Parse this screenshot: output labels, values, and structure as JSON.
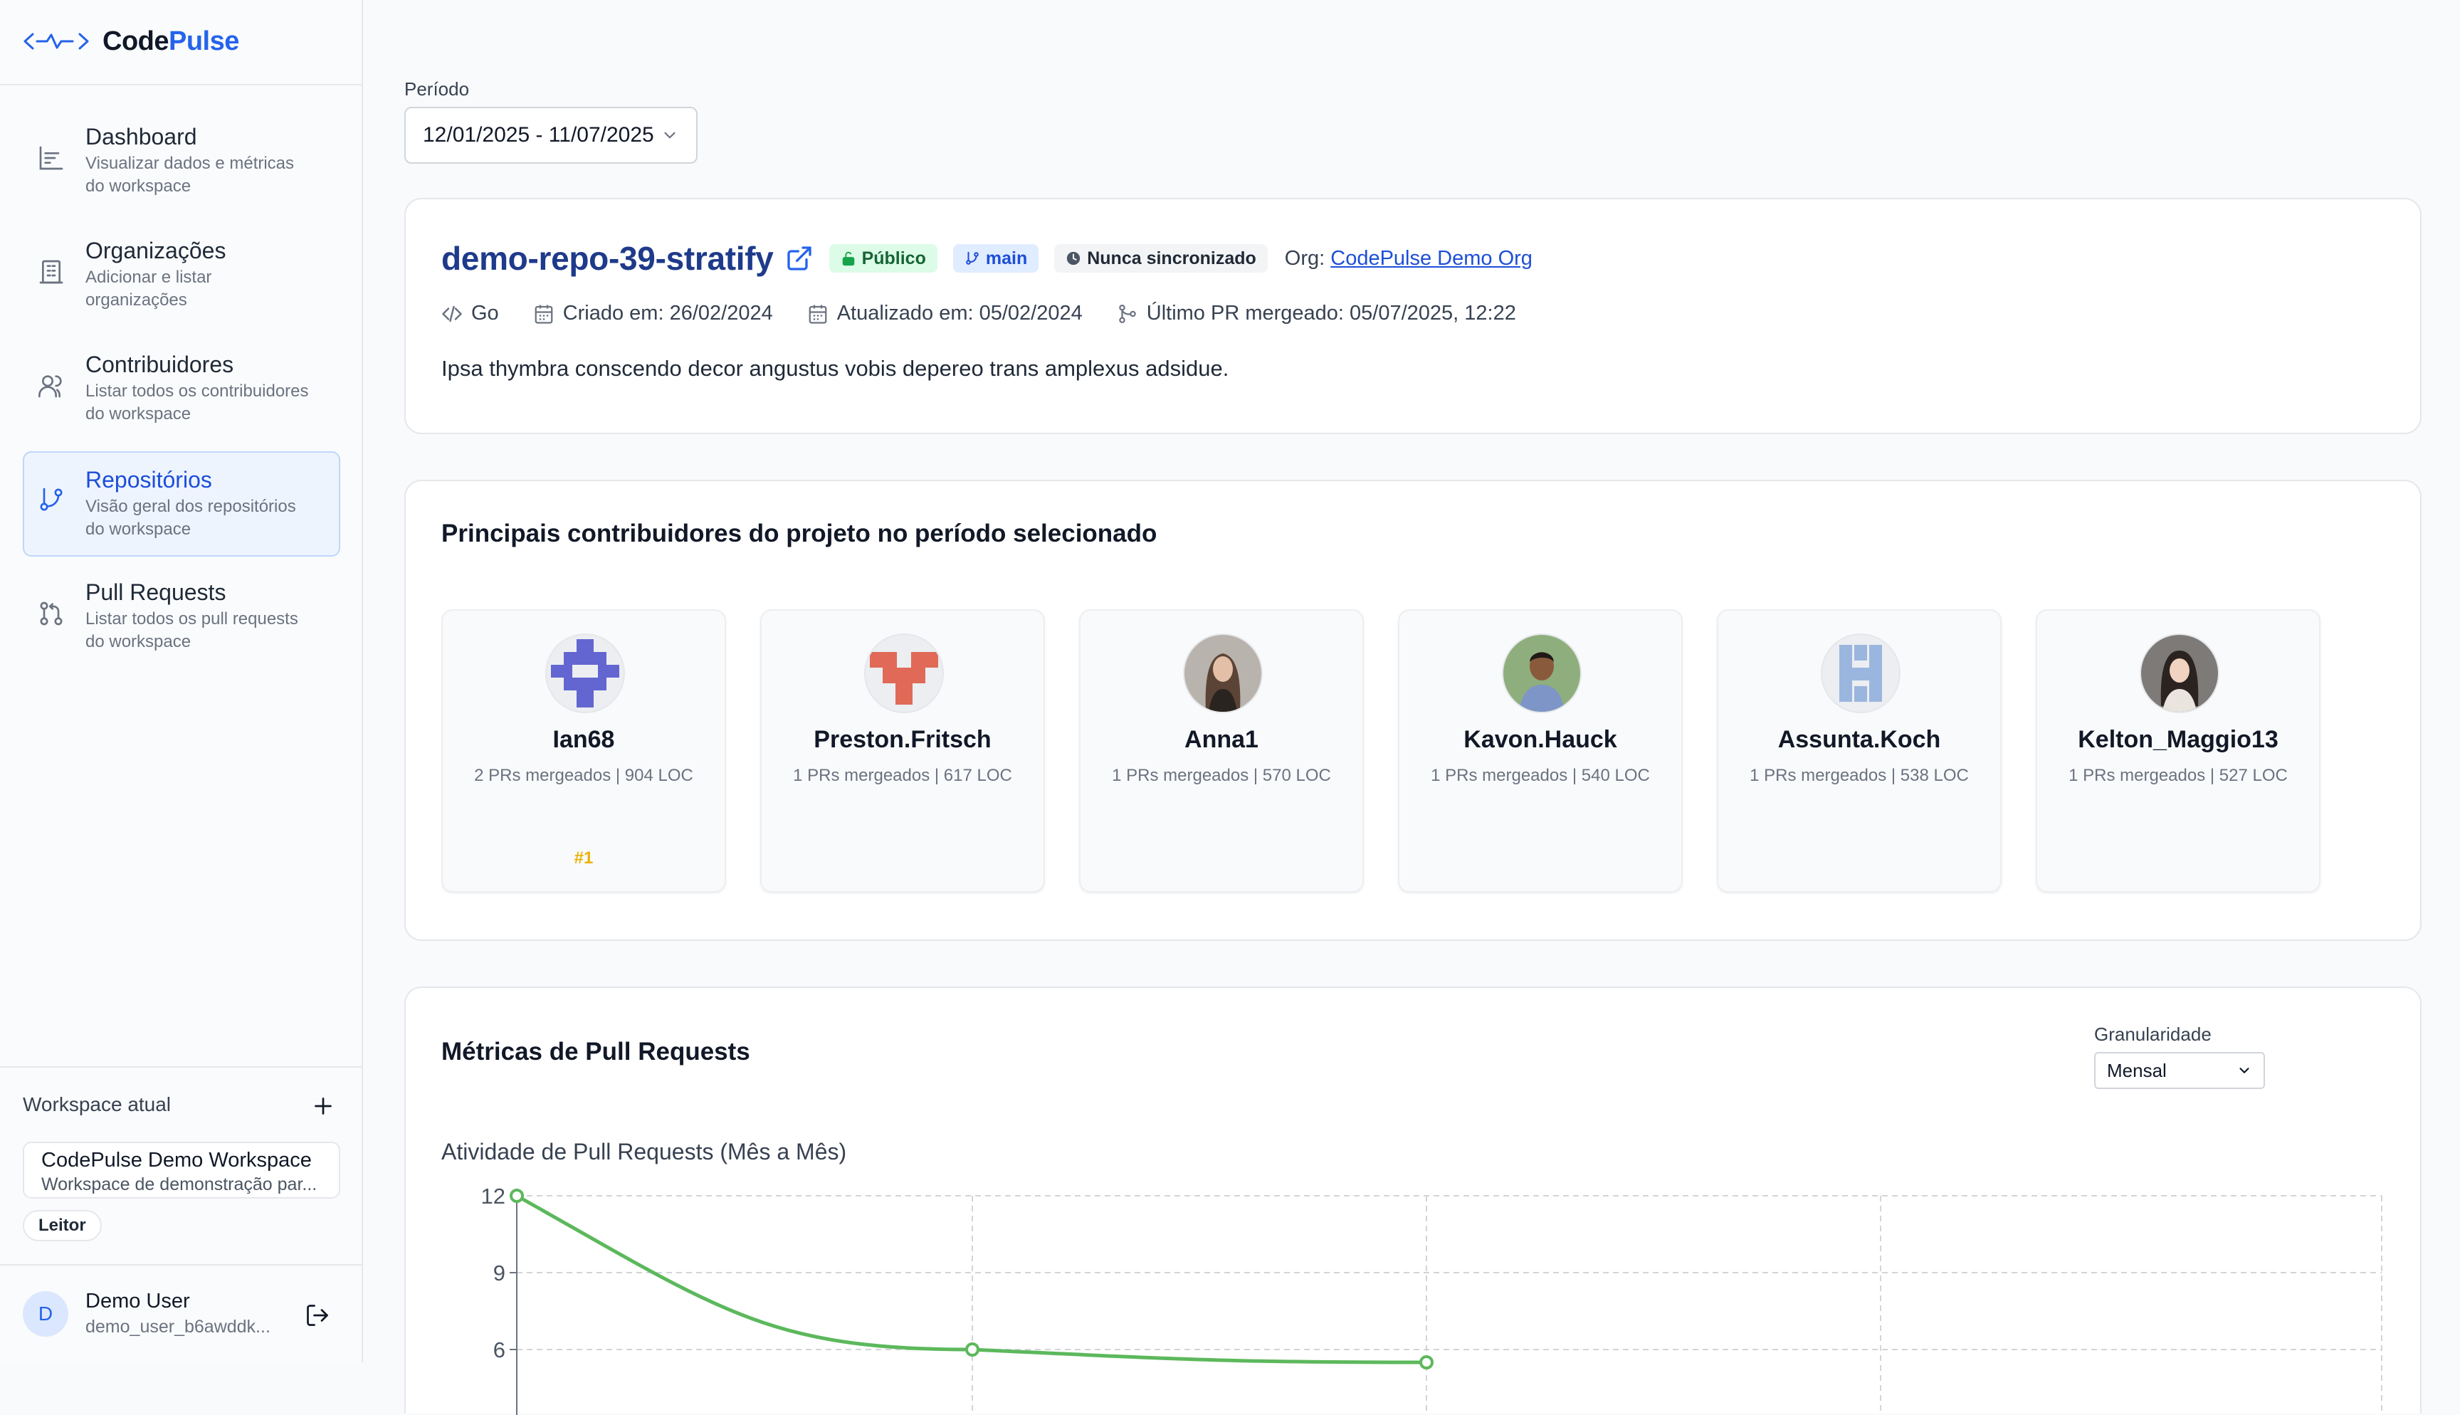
{
  "brand": {
    "name_a": "Code",
    "name_b": "Pulse"
  },
  "nav": [
    {
      "id": "dashboard",
      "label": "Dashboard",
      "sub": "Visualizar dados e métricas do workspace",
      "active": false
    },
    {
      "id": "organizacoes",
      "label": "Organizações",
      "sub": "Adicionar e listar organizações",
      "active": false
    },
    {
      "id": "contribuidores",
      "label": "Contribuidores",
      "sub": "Listar todos os contribuidores do workspace",
      "active": false
    },
    {
      "id": "repositorios",
      "label": "Repositórios",
      "sub": "Visão geral dos repositórios do workspace",
      "active": true
    },
    {
      "id": "pull-requests",
      "label": "Pull Requests",
      "sub": "Listar todos os pull requests do workspace",
      "active": false
    }
  ],
  "workspace": {
    "title": "Workspace atual",
    "name": "CodePulse Demo Workspace",
    "description": "Workspace de demonstração par...",
    "role": "Leitor"
  },
  "user": {
    "initial": "D",
    "name": "Demo User",
    "id": "demo_user_b6awddk..."
  },
  "period": {
    "label": "Período",
    "value": "12/01/2025 - 11/07/2025"
  },
  "repo": {
    "name": "demo-repo-39-stratify",
    "visibility": "Público",
    "branch": "main",
    "sync": "Nunca sincronizado",
    "org_label": "Org:",
    "org_name": "CodePulse Demo Org",
    "language": "Go",
    "created": "Criado em: 26/02/2024",
    "updated": "Atualizado em: 05/02/2024",
    "last_pr": "Último PR mergeado: 05/07/2025, 12:22",
    "description": "Ipsa thymbra conscendo decor angustus vobis depereo trans amplexus adsidue."
  },
  "contributors": {
    "title": "Principais contribuidores do projeto no período selecionado",
    "items": [
      {
        "name": "Ian68",
        "stats": "2 PRs mergeados | 904 LOC",
        "rank": "#1",
        "avatar": "identicon",
        "color": "#6366d1"
      },
      {
        "name": "Preston.Fritsch",
        "stats": "1 PRs mergeados | 617 LOC",
        "rank": "",
        "avatar": "identicon",
        "color": "#e06a57"
      },
      {
        "name": "Anna1",
        "stats": "1 PRs mergeados | 570 LOC",
        "rank": "",
        "avatar": "photo",
        "color": "#5b4436"
      },
      {
        "name": "Kavon.Hauck",
        "stats": "1 PRs mergeados | 540 LOC",
        "rank": "",
        "avatar": "photo",
        "color": "#6b4a32"
      },
      {
        "name": "Assunta.Koch",
        "stats": "1 PRs mergeados | 538 LOC",
        "rank": "",
        "avatar": "identicon",
        "color": "#9bb6de"
      },
      {
        "name": "Kelton_Maggio13",
        "stats": "1 PRs mergeados | 527 LOC",
        "rank": "",
        "avatar": "photo",
        "color": "#2b2320"
      }
    ]
  },
  "metrics": {
    "title": "Métricas de Pull Requests",
    "granularity_label": "Granularidade",
    "granularity_value": "Mensal"
  },
  "chart_data": {
    "type": "line",
    "title": "Atividade de Pull Requests (Mês a Mês)",
    "xlabel": "",
    "ylabel": "",
    "y_ticks": [
      12,
      9,
      6
    ],
    "grid": true,
    "series": [
      {
        "name": "",
        "color": "#5cb85c",
        "values": [
          12,
          6,
          5.5
        ]
      }
    ]
  },
  "colors": {
    "accent": "#2563eb",
    "chart_line": "#5cb85c"
  }
}
